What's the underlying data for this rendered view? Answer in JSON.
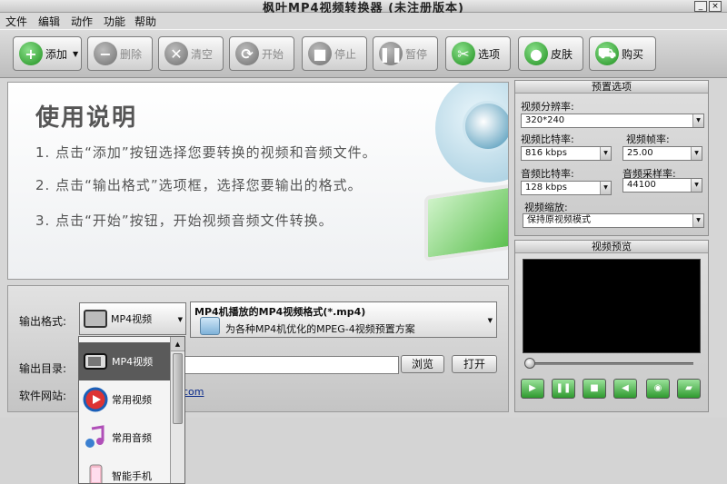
{
  "window": {
    "title": "枫叶MP4视频转换器  (未注册版本)",
    "min": "_",
    "close": "×"
  },
  "menu": [
    "文件",
    "编辑",
    "动作",
    "功能",
    "帮助"
  ],
  "toolbar": {
    "add": "添加",
    "delete": "删除",
    "clear": "清空",
    "start": "开始",
    "stop": "停止",
    "pause": "暂停",
    "options": "选项",
    "skin": "皮肤",
    "buy": "购买"
  },
  "instructions": {
    "heading": "使用说明",
    "step1": "1. 点击“添加”按钮选择您要转换的视频和音频文件。",
    "step2": "2. 点击“输出格式”选项框，选择您要输出的格式。",
    "step3": "3. 点击“开始”按钮，开始视频音频文件转换。"
  },
  "output": {
    "format_label": "输出格式:",
    "format_value": "MP4视频",
    "format_title": "MP4机播放的MP4视频格式(*.mp4)",
    "format_desc": "为各种MP4机优化的MPEG-4视频预置方案",
    "dir_label": "输出目录:",
    "browse": "浏览",
    "open": "打开",
    "site_label": "软件网站:",
    "site_link": "com"
  },
  "dropdown": {
    "items": [
      "MP4视频",
      "常用视频",
      "常用音频",
      "智能手机"
    ]
  },
  "presets": {
    "header": "预置选项",
    "resolution_label": "视频分辨率:",
    "resolution": "320*240",
    "vbitrate_label": "视频比特率:",
    "vbitrate": "816 kbps",
    "framerate_label": "视频帧率:",
    "framerate": "25.00",
    "abitrate_label": "音频比特率:",
    "abitrate": "128 kbps",
    "samplerate_label": "音频采样率:",
    "samplerate": "44100",
    "scale_label": "视频缩放:",
    "scale": "保持原视频模式"
  },
  "preview": {
    "header": "视频预览"
  }
}
